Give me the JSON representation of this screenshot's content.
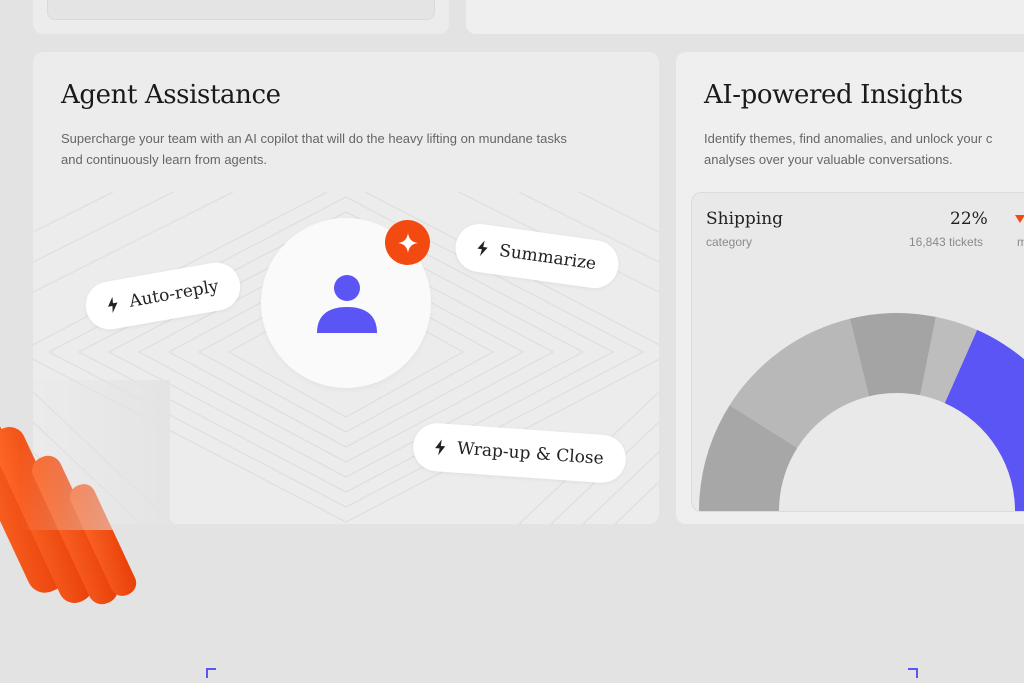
{
  "agent": {
    "title": "Agent Assistance",
    "description_line1": "Supercharge your team with an AI copilot that will do the heavy lifting on mundane tasks",
    "description_line2": "and continuously learn from agents.",
    "chips": {
      "auto_reply": "Auto-reply",
      "summarize": "Summarize",
      "wrap_up": "Wrap-up & Close"
    }
  },
  "insights": {
    "title": "AI-powered Insights",
    "description_line1": "Identify themes, find anomalies, and unlock your c",
    "description_line2": "analyses over your valuable conversations.",
    "stat": {
      "category": "Shipping",
      "category_label": "category",
      "percent": "22%",
      "tickets": "16,843 tickets",
      "trend_label": "m"
    }
  },
  "chart_data": {
    "type": "pie",
    "variant": "donut",
    "values": [
      22,
      4,
      8,
      14,
      18
    ],
    "colors": [
      "#5b55f5",
      "#bdbdbd",
      "#a4a4a4",
      "#b8b8b8",
      "#a7a7a7"
    ]
  },
  "colors": {
    "accent": "#5b55f5",
    "brand_orange": "#f24a10"
  },
  "icons": [
    "sparkle-icon",
    "user-icon",
    "lightning-icon"
  ]
}
